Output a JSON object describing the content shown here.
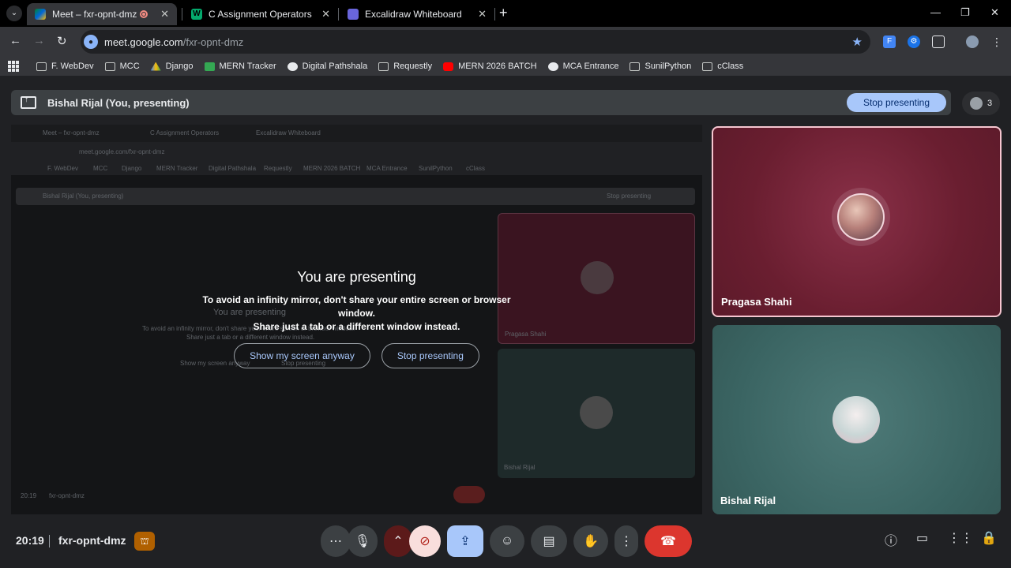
{
  "browser": {
    "tabs": [
      {
        "title": "Meet – fxr-opnt-dmz",
        "active": true,
        "favicon": "google-meet-icon",
        "recording": true
      },
      {
        "title": "C Assignment Operators",
        "active": false,
        "favicon": "w3schools-icon"
      },
      {
        "title": "Excalidraw Whiteboard",
        "active": false,
        "favicon": "excalidraw-icon"
      }
    ],
    "address": {
      "host": "meet.google.com",
      "path": "/fxr-opnt-dmz"
    },
    "bookmarks": [
      {
        "label": "F. WebDev",
        "icon": "folder-icon"
      },
      {
        "label": "MCC",
        "icon": "folder-icon"
      },
      {
        "label": "Django",
        "icon": "drive-icon"
      },
      {
        "label": "MERN Tracker",
        "icon": "sheets-icon"
      },
      {
        "label": "Digital Pathshala",
        "icon": "globe-icon"
      },
      {
        "label": "Requestly",
        "icon": "requestly-icon"
      },
      {
        "label": "MERN 2026 BATCH",
        "icon": "youtube-icon"
      },
      {
        "label": "MCA Entrance",
        "icon": "globe-icon"
      },
      {
        "label": "SunilPython",
        "icon": "folder-icon"
      },
      {
        "label": "cClass",
        "icon": "folder-icon"
      }
    ]
  },
  "meet": {
    "presenting_banner": "Bishal Rijal (You, presenting)",
    "stop_presenting_label": "Stop presenting",
    "participant_count": "3",
    "overlay": {
      "title": "You are presenting",
      "message_line1": "To avoid an infinity mirror, don't share your entire screen or browser window.",
      "message_line2": "Share just a tab or a different window instead.",
      "show_anyway_label": "Show my screen anyway",
      "stop_label": "Stop presenting"
    },
    "participants": [
      {
        "name": "Pragasa Shahi",
        "accent": "#6a1e30",
        "speaking": true
      },
      {
        "name": "Bishal Rijal",
        "accent": "#3a6462",
        "speaking": false
      }
    ],
    "time": "20:19",
    "meeting_code": "fxr-opnt-dmz",
    "controls": [
      "more-options-icon",
      "microphone-icon",
      "chevron-up-icon",
      "camera-off-icon",
      "present-screen-icon",
      "emoji-icon",
      "captions-icon",
      "raise-hand-icon",
      "more-vert-icon",
      "end-call-icon"
    ],
    "right_controls": [
      "info-icon",
      "chat-icon",
      "activities-icon",
      "host-controls-icon"
    ]
  },
  "mirror": {
    "tab1": "Meet – fxr-opnt-dmz",
    "tab2": "C Assignment Operators",
    "tab3": "Excalidraw Whiteboard",
    "url": "meet.google.com/fxr-opnt-dmz",
    "banner": "Bishal Rijal (You, presenting)",
    "stop": "Stop presenting",
    "ghost_title": "You are presenting",
    "ghost_msg1": "To avoid an infinity mirror, don't share your entire screen or browser window.",
    "ghost_msg2": "Share just a tab or a different window instead.",
    "ghost_btn1": "Show my screen anyway",
    "ghost_btn2": "Stop presenting",
    "name1": "Pragasa Shahi",
    "name2": "Bishal Rijal",
    "time": "20:19",
    "code": "fxr-opnt-dmz",
    "bookmarks": [
      "F. WebDev",
      "MCC",
      "Django",
      "MERN Tracker",
      "Digital Pathshala",
      "Requestly",
      "MERN 2026 BATCH",
      "MCA Entrance",
      "SunilPython",
      "cClass"
    ]
  },
  "colors": {
    "accent": "#a8c7fa",
    "end_call": "#dc362e",
    "tile_speaking_border": "#f6c6d0"
  }
}
